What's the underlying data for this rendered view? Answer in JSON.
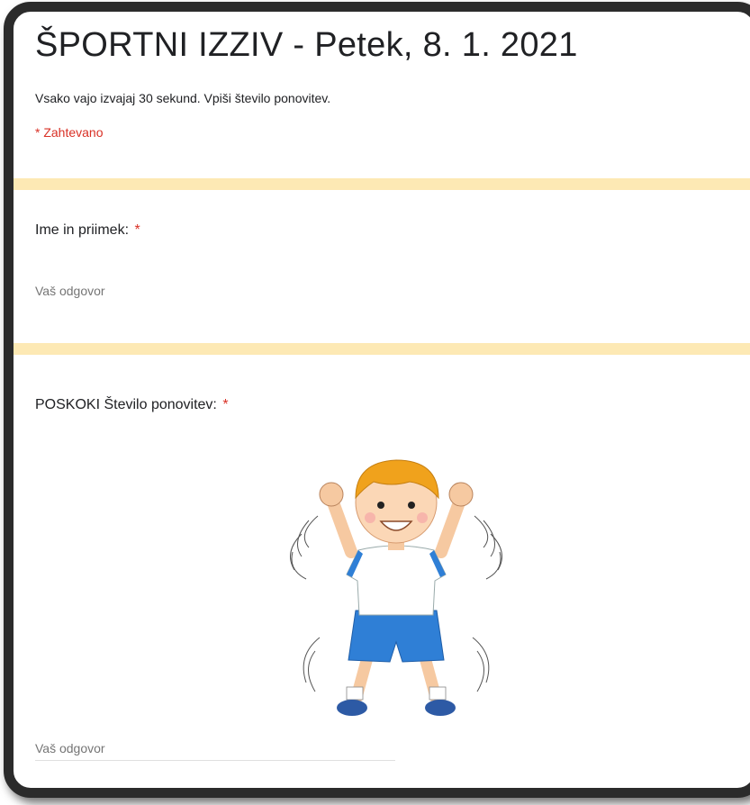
{
  "form": {
    "title": "ŠPORTNI IZZIV - Petek, 8. 1. 2021",
    "description": "Vsako vajo izvajaj 30 sekund. Vpiši število ponovitev.",
    "required_note": "* Zahtevano"
  },
  "questions": [
    {
      "label": "Ime in priimek:",
      "required_mark": "*",
      "placeholder": "Vaš odgovor"
    },
    {
      "label": "POSKOKI Število ponovitev:",
      "required_mark": "*",
      "placeholder": "Vaš odgovor"
    }
  ],
  "colors": {
    "section_band": "#fde9b4",
    "required": "#d93025",
    "text": "#202124"
  },
  "icons": {
    "illustration": "jumping-jack-boy-illustration"
  }
}
